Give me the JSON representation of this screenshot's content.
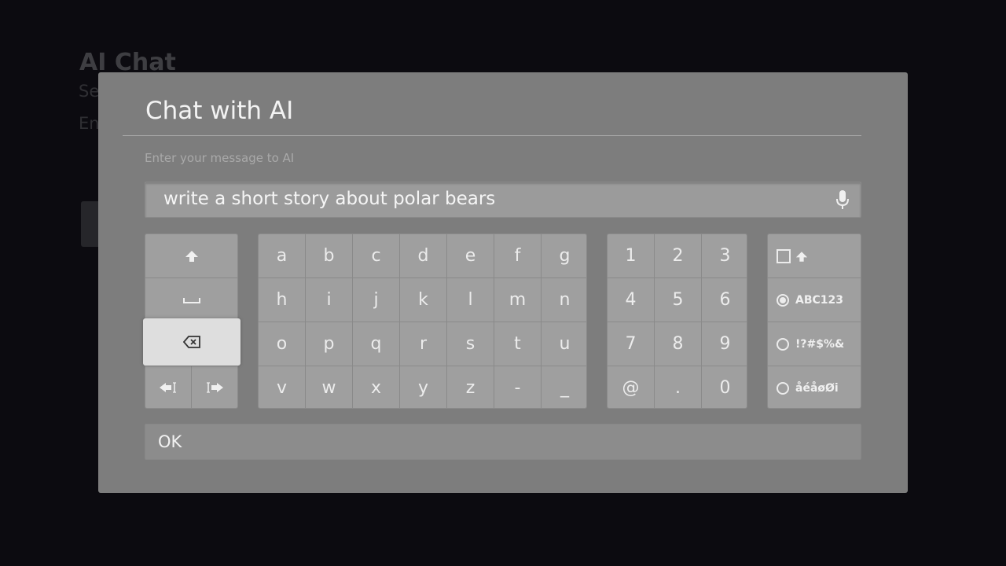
{
  "background": {
    "title": "AI Chat",
    "line1": "Se",
    "line2": "En"
  },
  "dialog": {
    "title": "Chat with AI",
    "prompt": "Enter your message to AI",
    "input_value": "write a short story about polar bears",
    "ok_label": "OK"
  },
  "keyboard": {
    "letter_rows": [
      [
        "a",
        "b",
        "c",
        "d",
        "e",
        "f",
        "g"
      ],
      [
        "h",
        "i",
        "j",
        "k",
        "l",
        "m",
        "n"
      ],
      [
        "o",
        "p",
        "q",
        "r",
        "s",
        "t",
        "u"
      ],
      [
        "v",
        "w",
        "x",
        "y",
        "z",
        "-",
        "_"
      ]
    ],
    "number_rows": [
      [
        "1",
        "2",
        "3"
      ],
      [
        "4",
        "5",
        "6"
      ],
      [
        "7",
        "8",
        "9"
      ],
      [
        "@",
        ".",
        "0"
      ]
    ],
    "control_keys": {
      "shift": "shift-icon",
      "space": "space-icon",
      "delete": "backspace-icon",
      "cursor_left": "cursor-left-icon",
      "cursor_right": "cursor-right-icon"
    },
    "modes": {
      "caps_lock_icon": "shift-icon",
      "abc123": "ABC123",
      "symbols": "!?#$%&",
      "accents": "åéåøØi",
      "selected": "ABC123"
    }
  },
  "colors": {
    "page_bg": "#0c0b10",
    "dialog_bg": "#7d7d7d",
    "key_bg": "#9f9f9f",
    "focus_bg": "#dedede"
  }
}
